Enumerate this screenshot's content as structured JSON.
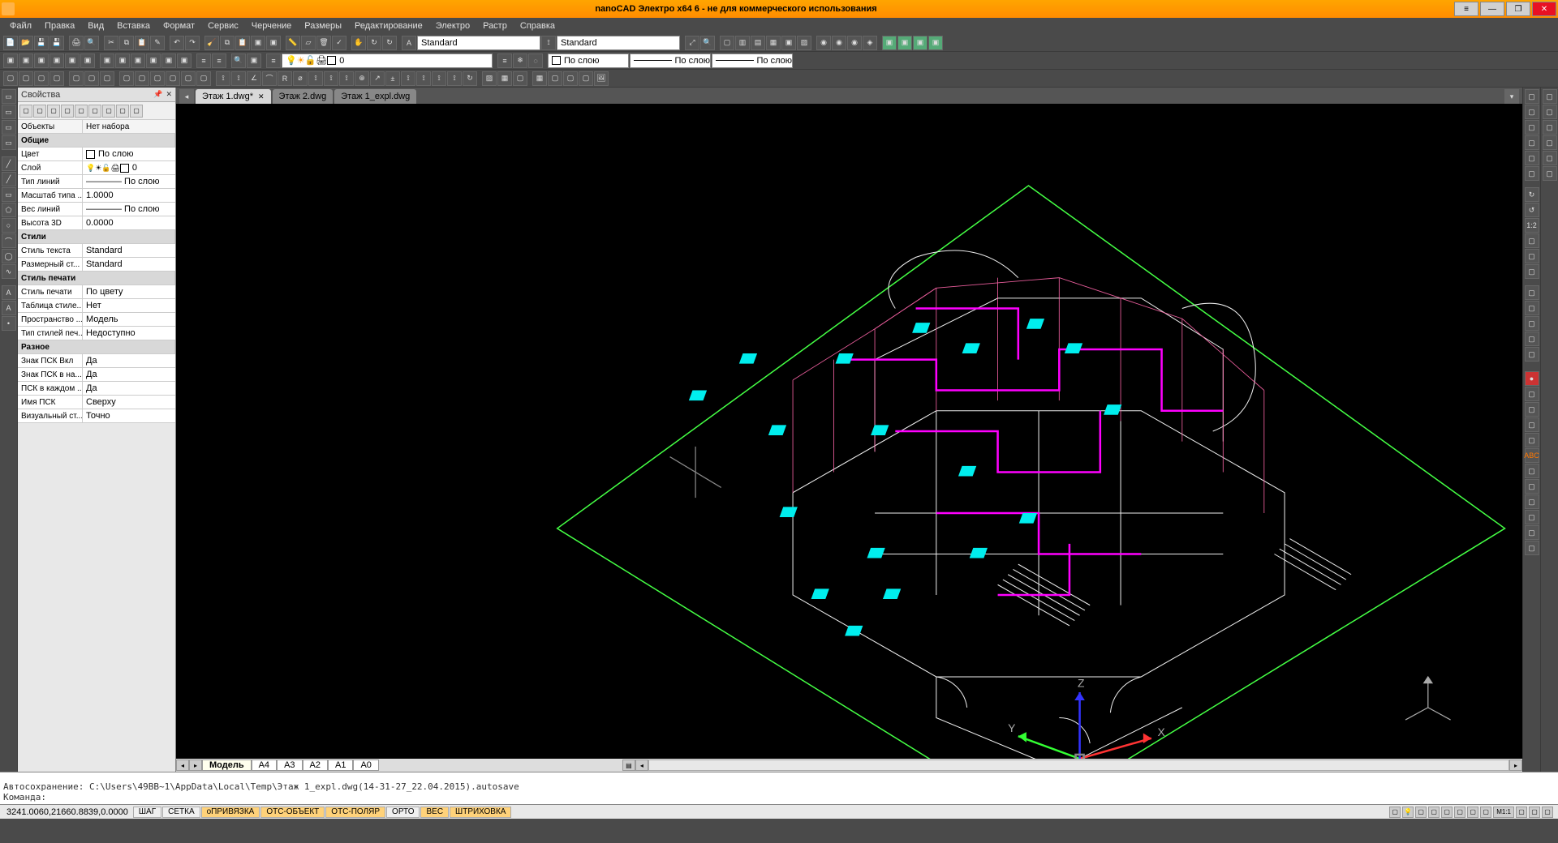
{
  "title": "nanoCAD Электро x64 6 - не для коммерческого использования",
  "menu": [
    "Файл",
    "Правка",
    "Вид",
    "Вставка",
    "Формат",
    "Сервис",
    "Черчение",
    "Размеры",
    "Редактирование",
    "Электро",
    "Растр",
    "Справка"
  ],
  "combos": {
    "textstyle": "Standard",
    "dimstyle": "Standard",
    "layer": "0",
    "color": "По слою",
    "linetype": "По слою",
    "lineweight": "По слою"
  },
  "tabs": [
    {
      "label": "Этаж 1.dwg*",
      "active": true,
      "closable": true
    },
    {
      "label": "Этаж 2.dwg",
      "active": false,
      "closable": false
    },
    {
      "label": "Этаж 1_expl.dwg",
      "active": false,
      "closable": false
    }
  ],
  "layout_tabs": [
    "Модель",
    "A4",
    "A3",
    "A2",
    "A1",
    "A0"
  ],
  "props": {
    "panel_title": "Свойства",
    "objects_label": "Объекты",
    "objects_value": "Нет набора",
    "groups": [
      {
        "name": "Общие",
        "rows": [
          {
            "k": "Цвет",
            "v": "По слою",
            "swatch": "#fff"
          },
          {
            "k": "Слой",
            "v": "0",
            "icons": true
          },
          {
            "k": "Тип линий",
            "v": "———— По слою"
          },
          {
            "k": "Масштаб типа ...",
            "v": "1.0000"
          },
          {
            "k": "Вес линий",
            "v": "———— По слою"
          },
          {
            "k": "Высота 3D",
            "v": "0.0000"
          }
        ]
      },
      {
        "name": "Стили",
        "rows": [
          {
            "k": "Стиль текста",
            "v": "Standard"
          },
          {
            "k": "Размерный ст...",
            "v": "Standard"
          }
        ]
      },
      {
        "name": "Стиль печати",
        "rows": [
          {
            "k": "Стиль печати",
            "v": "По цвету"
          },
          {
            "k": "Таблица стиле...",
            "v": "Нет"
          },
          {
            "k": "Пространство ...",
            "v": "Модель"
          },
          {
            "k": "Тип стилей печ...",
            "v": "Недоступно"
          }
        ]
      },
      {
        "name": "Разное",
        "rows": [
          {
            "k": "Знак ПСК Вкл",
            "v": "Да"
          },
          {
            "k": "Знак ПСК в на...",
            "v": "Да"
          },
          {
            "k": "ПСК в каждом ...",
            "v": "Да"
          },
          {
            "k": "Имя ПСК",
            "v": "Сверху"
          },
          {
            "k": "Визуальный ст...",
            "v": "Точно"
          }
        ]
      }
    ]
  },
  "cmd": {
    "line1": "Автосохранение: C:\\Users\\49BB~1\\AppData\\Local\\Temp\\Этаж 1_expl.dwg(14-31-27_22.04.2015).autosave",
    "line2": "Команда:"
  },
  "status": {
    "coords": "3241.0060,21660.8839,0.0000",
    "toggles": [
      {
        "label": "ШАГ",
        "on": false
      },
      {
        "label": "СЕТКА",
        "on": false
      },
      {
        "label": "оПРИВЯЗКА",
        "on": true
      },
      {
        "label": "ОТС-ОБЪЕКТ",
        "on": true
      },
      {
        "label": "ОТС-ПОЛЯР",
        "on": true
      },
      {
        "label": "ОРТО",
        "on": false
      },
      {
        "label": "ВЕС",
        "on": true
      },
      {
        "label": "ШТРИХОВКА",
        "on": true
      }
    ],
    "scale": "М1:1"
  },
  "axes": {
    "x": "X",
    "y": "Y",
    "z": "Z"
  }
}
